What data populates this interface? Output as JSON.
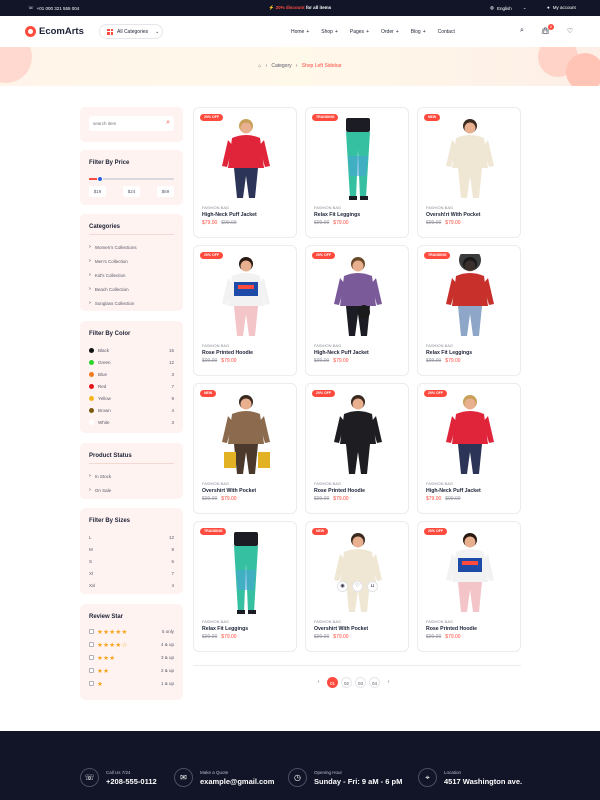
{
  "topbar": {
    "phone": "+01 000 321 555 004",
    "promo_highlight": "20% discount",
    "promo_rest": "for all items",
    "language": "English",
    "account": "My account"
  },
  "header": {
    "brand": "EcomArts",
    "categories_button": "All Categories",
    "nav": [
      "Home",
      "Shop",
      "Pages",
      "Order",
      "Blog",
      "Contact"
    ],
    "cart_count": "0"
  },
  "breadcrumb": {
    "home_icon": "home-icon",
    "category": "Category",
    "current": "Shop Left Sidebar"
  },
  "sidebar": {
    "search_placeholder": "search item",
    "price": {
      "title": "Filter By Price",
      "min": "$19",
      "mid": "$24",
      "max": "$69",
      "handle_position": 0.13
    },
    "categories": {
      "title": "Categories",
      "items": [
        "Women's Collections",
        "Men's Collection",
        "Kid's Collection",
        "Beach Collection",
        "Sunglass Collection"
      ]
    },
    "colors": {
      "title": "Filter By Color",
      "items": [
        {
          "name": "Black",
          "count": "15",
          "hex": "#111111"
        },
        {
          "name": "Green",
          "count": "12",
          "hex": "#2bd42b"
        },
        {
          "name": "Blue",
          "count": "3",
          "hex": "#f27b20"
        },
        {
          "name": "Red",
          "count": "7",
          "hex": "#e3141b"
        },
        {
          "name": "Yellow",
          "count": "9",
          "hex": "#f6b61c"
        },
        {
          "name": "Brown",
          "count": "4",
          "hex": "#7a5a10"
        },
        {
          "name": "White",
          "count": "3",
          "hex": "#ffffff"
        }
      ]
    },
    "status": {
      "title": "Product Status",
      "items": [
        "In Stock",
        "On Sale"
      ]
    },
    "sizes": {
      "title": "Filter By Sizes",
      "items": [
        {
          "name": "L",
          "count": "12"
        },
        {
          "name": "M",
          "count": "8"
        },
        {
          "name": "S",
          "count": "6"
        },
        {
          "name": "Xl",
          "count": "7"
        },
        {
          "name": "Xxl",
          "count": "4"
        }
      ]
    },
    "review": {
      "title": "Review Star",
      "items": [
        {
          "stars": "★★★★★",
          "label": "5 only"
        },
        {
          "stars": "★★★★☆",
          "label": "4 & up"
        },
        {
          "stars": "★★★",
          "label": "3 & up"
        },
        {
          "stars": "★★",
          "label": "2 & up"
        },
        {
          "stars": "★",
          "label": "1 & up"
        }
      ]
    }
  },
  "products": [
    {
      "badge": "20% OFF",
      "category": "FASHION BAG",
      "name": "High-Neck Puff Jacket",
      "price": "$79.00",
      "old_price": "$99.00",
      "order": "new-first",
      "img": "red-jacket"
    },
    {
      "badge": "TRANDING",
      "category": "FASHION BAG",
      "name": "Relax Fit Leggings",
      "price": "$79.00",
      "old_price": "$99.00",
      "order": "old-first",
      "img": "leggings"
    },
    {
      "badge": "NEW",
      "category": "FASHION BAG",
      "name": "Oversh!rt With Pocket",
      "price": "$79.00",
      "old_price": "$99.00",
      "order": "old-first",
      "img": "shirt"
    },
    {
      "badge": "20% OFF",
      "category": "FASHION BAG",
      "name": "Rose Printed Hoodie",
      "price": "$79.00",
      "old_price": "$99.00",
      "order": "old-first",
      "img": "hoodie"
    },
    {
      "badge": "20% OFF",
      "category": "FASHION BAG",
      "name": "High-Neck Puff Jacket",
      "price": "$79.00",
      "old_price": "$99.00",
      "order": "old-first",
      "img": "fur-coat"
    },
    {
      "badge": "TRANDING",
      "category": "FASHION BAG",
      "name": "Relax Fit Leggings",
      "price": "$79.00",
      "old_price": "$99.00",
      "order": "old-first",
      "img": "red-blazer"
    },
    {
      "badge": "NEW",
      "category": "FASHION BAG",
      "name": "Overshirt With Pocket",
      "price": "$79.00",
      "old_price": "$99.00",
      "order": "old-first",
      "img": "brown-blazer"
    },
    {
      "badge": "20% OFF",
      "category": "FASHION BAG",
      "name": "Rose Printed Hoodie",
      "price": "$79.00",
      "old_price": "$99.00",
      "order": "old-first",
      "img": "leather-jacket"
    },
    {
      "badge": "20% OFF",
      "category": "FASHION BAG",
      "name": "High-Neck Puff Jacket",
      "price": "$79.00",
      "old_price": "$99.00",
      "order": "new-first",
      "img": "red-jacket"
    },
    {
      "badge": "TRANDING",
      "category": "FASHION BAG",
      "name": "Relax Fit Leggings",
      "price": "$79.00",
      "old_price": "$99.00",
      "order": "old-first",
      "img": "leggings"
    },
    {
      "badge": "NEW",
      "category": "FASHION BAG",
      "name": "Overshirt With Pocket",
      "price": "$79.00",
      "old_price": "$99.00",
      "order": "old-first",
      "img": "shirt",
      "actions": [
        "eye-icon",
        "heart-icon",
        "bag-icon"
      ]
    },
    {
      "badge": "20% OFF",
      "category": "FASHION BAG",
      "name": "Rose Printed Hoodie",
      "price": "$79.00",
      "old_price": "$99.00",
      "order": "old-first",
      "img": "hoodie"
    }
  ],
  "pagination": {
    "prev": "‹",
    "pages": [
      "01",
      "02",
      "03",
      "04"
    ],
    "active": "01",
    "next": "›"
  },
  "footer": [
    {
      "icon": "phone-icon",
      "label": "Call Us 7/24",
      "value": "+208-555-0112"
    },
    {
      "icon": "mail-icon",
      "label": "Make a Quote",
      "value": "example@gmail.com"
    },
    {
      "icon": "clock-icon",
      "label": "Opening Hour",
      "value": "Sunday - Fri: 9 aM - 6 pM"
    },
    {
      "icon": "location-icon",
      "label": "Location",
      "value": "4517 Washington ave."
    }
  ],
  "colors": {
    "accent": "#ff4b3e",
    "dark": "#111527",
    "sidebar_bg": "#fff3f1"
  }
}
